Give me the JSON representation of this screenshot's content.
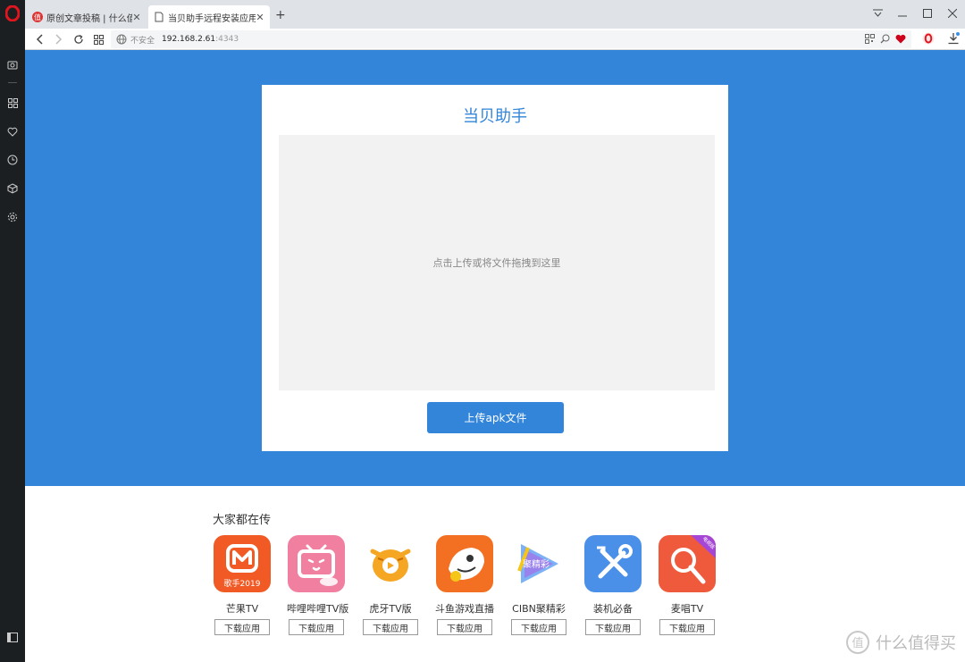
{
  "browser": {
    "tabs": [
      {
        "title": "原创文章投稿 | 什么值得买",
        "active": false
      },
      {
        "title": "当贝助手远程安装应用",
        "active": true
      }
    ],
    "new_tab_label": "+",
    "address": {
      "security_label": "不安全",
      "host": "192.168.2.61",
      "port": ":4343"
    }
  },
  "card": {
    "title": "当贝助手",
    "dropzone_hint": "点击上传或将文件拖拽到这里",
    "upload_label": "上传apk文件"
  },
  "apps_section": {
    "heading": "大家都在传",
    "download_label": "下载应用",
    "items": [
      {
        "name": "芒果TV",
        "icon": "mango-tv-icon",
        "icon_text": "歌手2019"
      },
      {
        "name": "哔哩哔哩TV版",
        "icon": "bilibili-icon"
      },
      {
        "name": "虎牙TV版",
        "icon": "huya-icon"
      },
      {
        "name": "斗鱼游戏直播",
        "icon": "douyu-icon"
      },
      {
        "name": "CIBN聚精彩",
        "icon": "cibn-icon",
        "icon_text": "聚精彩"
      },
      {
        "name": "装机必备",
        "icon": "tools-icon"
      },
      {
        "name": "麦唱TV",
        "icon": "maichang-icon",
        "icon_text": "电视版"
      }
    ]
  },
  "watermark": {
    "text": "什么值得买",
    "icon_text": "值"
  },
  "colors": {
    "accent": "#3285d9",
    "sidebar": "#1c1f22",
    "opera_red": "#e0161e"
  }
}
